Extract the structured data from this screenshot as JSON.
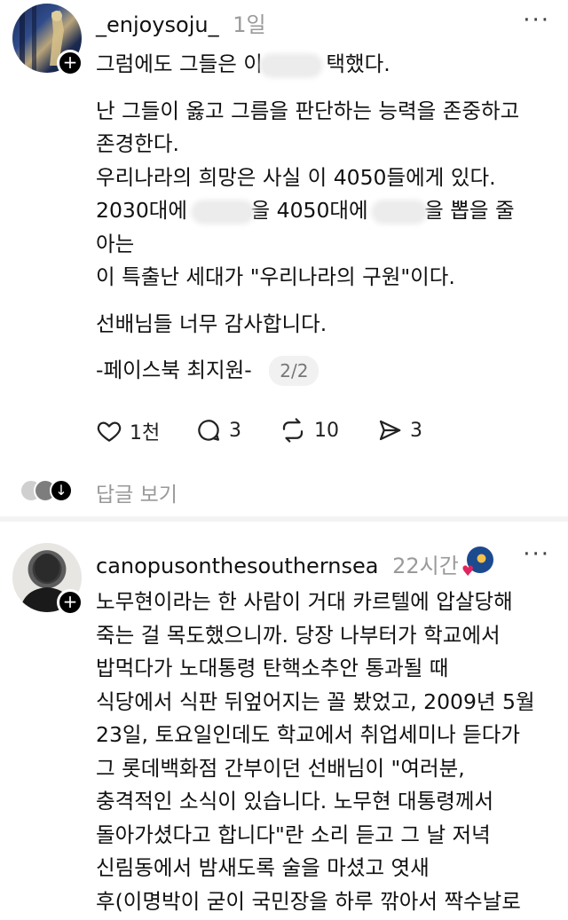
{
  "post1": {
    "username": "_enjoysoju_",
    "time": "1일",
    "lines": [
      "그럼에도 그들은 이",
      "택했다.",
      "난 그들이 옳고 그름을 판단하는 능력을 존중하고",
      "존경한다.",
      "우리나라의 희망은 사실 이 4050들에게 있다.",
      "2030대에",
      "을 4050대에",
      "을 뽑을 줄",
      "아는",
      "이 특출난 세대가 \"우리나라의 구원\"이다.",
      "선배님들 너무  감사합니다.",
      "-페이스북 최지원-"
    ],
    "pager": "2/2",
    "likes": "1천",
    "comments": "3",
    "reposts": "10",
    "shares": "3",
    "replies_label": "답글 보기"
  },
  "post2": {
    "username": "canopusonthesouthernsea",
    "time": "22시간",
    "lines": [
      "노무현이라는 한 사람이 거대 카르텔에 압살당해",
      "죽는 걸 목도했으니까. 당장 나부터가 학교에서",
      "밥먹다가 노대통령 탄핵소추안 통과될 때",
      "식당에서 식판 뒤엎어지는 꼴 봤었고, 2009년 5월",
      "23일, 토요일인데도 학교에서 취업세미나 듣다가",
      "그 롯데백화점 간부이던 선배님이 \"여러분,",
      "충격적인 소식이 있습니다. 노무현 대통령께서",
      "돌아가셨다고 합니다\"란 소리 듣고 그 날 저녁",
      "신림동에서 밤새도록 술을 마셨고 엿새",
      "후(이명박이 굳이 국민장을 하루 깎아서 짝수날로"
    ]
  },
  "ui": {
    "more_glyph": "···",
    "plus_glyph": "+"
  },
  "colors": {
    "text": "#111111",
    "muted": "#9a9a9a",
    "heart": "#e0245e"
  }
}
